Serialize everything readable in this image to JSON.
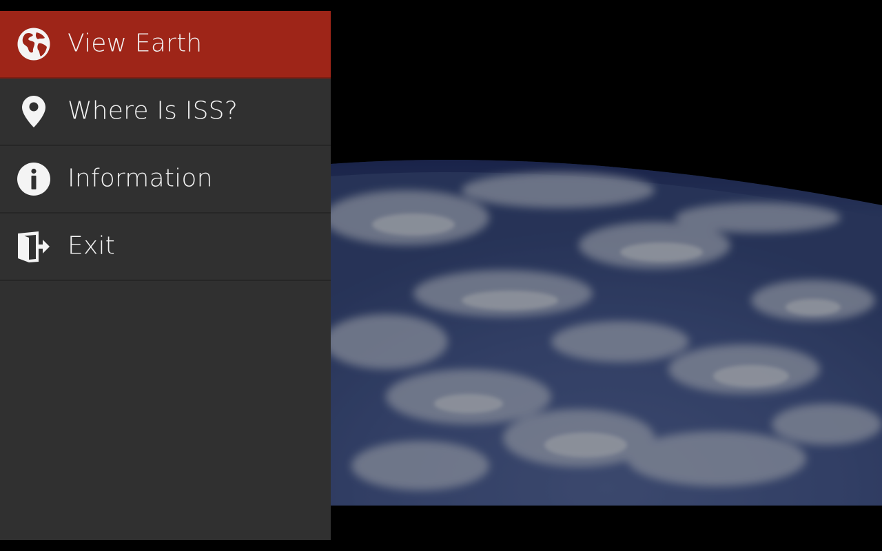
{
  "drawer": {
    "items": [
      {
        "label": "View Earth",
        "icon": "globe-icon",
        "active": true
      },
      {
        "label": "Where Is ISS?",
        "icon": "map-pin-icon",
        "active": false
      },
      {
        "label": "Information",
        "icon": "info-icon",
        "active": false
      },
      {
        "label": "Exit",
        "icon": "exit-door-icon",
        "active": false
      }
    ]
  },
  "colors": {
    "active_item": "#9e2518",
    "drawer_background": "#303030",
    "label_text": "#f2f2f2",
    "earth_blue": "#4a5f93"
  }
}
